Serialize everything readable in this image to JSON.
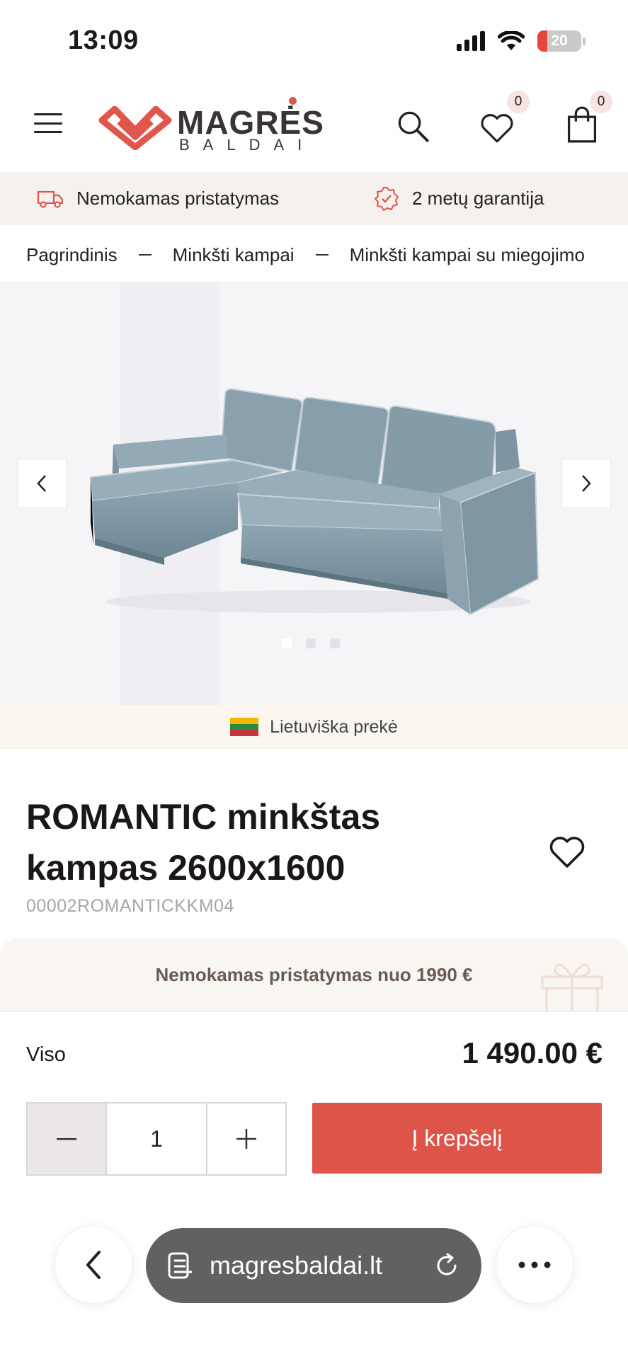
{
  "status_bar": {
    "time": "13:09",
    "battery": "20"
  },
  "header": {
    "logo_name": "MAGRĖS",
    "logo_sub": "BALDAI",
    "wishlist_count": "0",
    "cart_count": "0"
  },
  "info_bar": {
    "delivery": "Nemokamas pristatymas",
    "warranty": "2 metų garantija"
  },
  "breadcrumb": [
    "Pagrindinis",
    "Minkšti kampai",
    "Minkšti kampai su miegojimo"
  ],
  "gallery": {
    "origin_label": "Lietuviška prekė",
    "slides": 3,
    "active_slide": 1
  },
  "product": {
    "title": "ROMANTIC minkštas kampas 2600x1600",
    "sku": "00002ROMANTICKKM04",
    "promo": "Nemokamas pristatymas nuo 1990 €",
    "total_label": "Viso",
    "total_price": "1 490.00 €",
    "quantity": "1",
    "add_to_cart": "Į krepšelį"
  },
  "browser": {
    "url": "magresbaldai.lt"
  },
  "colors": {
    "accent": "#dd5449",
    "info_bg": "#f6f1ee",
    "url_bar": "#616161"
  }
}
